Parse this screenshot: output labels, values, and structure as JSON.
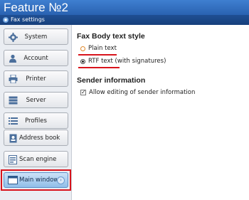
{
  "window": {
    "title": "Feature №2",
    "subtitle": "Fax settings",
    "subtitle_icon": "gear-icon"
  },
  "sidebar": {
    "items": [
      {
        "label": "System",
        "icon": "gear-icon"
      },
      {
        "label": "Account",
        "icon": "user-icon"
      },
      {
        "label": "Printer",
        "icon": "printer-icon"
      },
      {
        "label": "Server",
        "icon": "server-icon"
      },
      {
        "label": "Profiles",
        "icon": "list-icon"
      },
      {
        "label": "Address book",
        "icon": "address-book-icon"
      },
      {
        "label": "Scan engine",
        "icon": "scanner-icon"
      }
    ],
    "main_window": {
      "label": "Main window",
      "icon": "window-icon",
      "arrow": "›"
    }
  },
  "fax_body": {
    "title": "Fax Body text style",
    "options": [
      {
        "label": "Plain text",
        "selected": false
      },
      {
        "label": "RTF text (with signatures)",
        "selected": true
      }
    ]
  },
  "sender": {
    "title": "Sender information",
    "allow_editing_label": "Allow editing of sender information",
    "allow_editing_checked": true
  },
  "colors": {
    "title_bar": "#2a62b1",
    "highlight": "#d8141c",
    "sidebar_bg": "#eaedf2"
  }
}
